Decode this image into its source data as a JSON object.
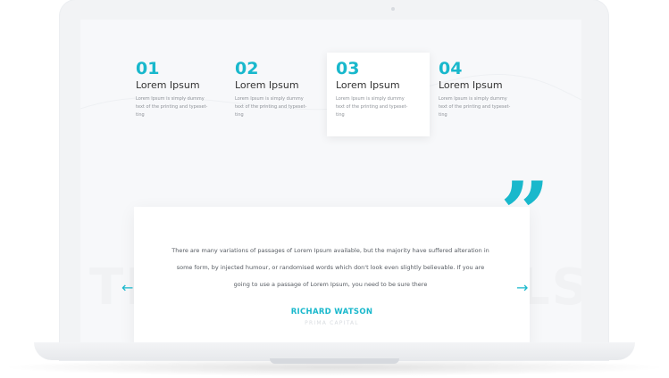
{
  "steps": [
    {
      "number": "01",
      "title": "Lorem Ipsum",
      "desc": "Lorem Ipsum is simply dummy text of the printing and typeset-ting"
    },
    {
      "number": "02",
      "title": "Lorem Ipsum",
      "desc": "Lorem Ipsum is simply dummy text of the printing and typeset-ting"
    },
    {
      "number": "03",
      "title": "Lorem Ipsum",
      "desc": "Lorem Ipsum is simply dummy text of the printing and typeset-ting"
    },
    {
      "number": "04",
      "title": "Lorem Ipsum",
      "desc": "Lorem Ipsum is simply dummy text of the printing and typeset-ting"
    }
  ],
  "active_step": "03",
  "background_word_left": "TE",
  "background_word_right": "LS",
  "testimonial": {
    "quote": "There are many variations of passages of Lorem Ipsum available, but the majority have suffered alteration in some form, by injected humour, or randomised words which don't look even slightly believable. If you are going to use a passage of Lorem Ipsum, you need to be sure there",
    "author": "RICHARD WATSON",
    "company": "PRIMA CAPITAL"
  },
  "icons": {
    "quote": "quote-icon",
    "prev": "arrow-left-icon",
    "next": "arrow-right-icon"
  },
  "colors": {
    "accent": "#19b8cc",
    "text": "#333333",
    "muted": "#8f9399"
  }
}
